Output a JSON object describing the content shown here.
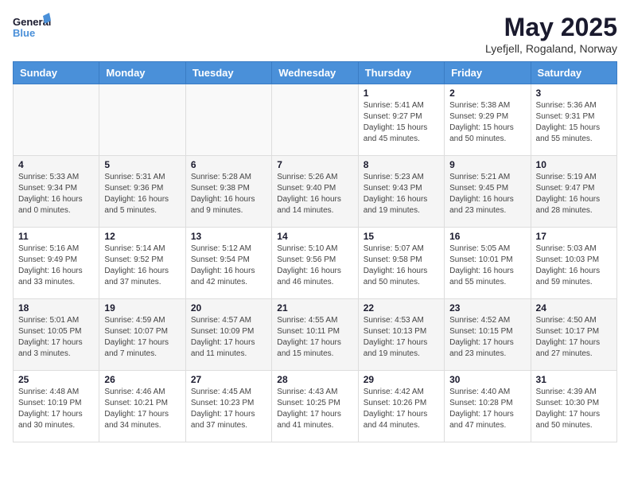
{
  "logo": {
    "line1": "General",
    "line2": "Blue"
  },
  "header": {
    "month": "May 2025",
    "location": "Lyefjell, Rogaland, Norway"
  },
  "weekdays": [
    "Sunday",
    "Monday",
    "Tuesday",
    "Wednesday",
    "Thursday",
    "Friday",
    "Saturday"
  ],
  "weeks": [
    [
      {
        "day": "",
        "info": ""
      },
      {
        "day": "",
        "info": ""
      },
      {
        "day": "",
        "info": ""
      },
      {
        "day": "",
        "info": ""
      },
      {
        "day": "1",
        "info": "Sunrise: 5:41 AM\nSunset: 9:27 PM\nDaylight: 15 hours\nand 45 minutes."
      },
      {
        "day": "2",
        "info": "Sunrise: 5:38 AM\nSunset: 9:29 PM\nDaylight: 15 hours\nand 50 minutes."
      },
      {
        "day": "3",
        "info": "Sunrise: 5:36 AM\nSunset: 9:31 PM\nDaylight: 15 hours\nand 55 minutes."
      }
    ],
    [
      {
        "day": "4",
        "info": "Sunrise: 5:33 AM\nSunset: 9:34 PM\nDaylight: 16 hours\nand 0 minutes."
      },
      {
        "day": "5",
        "info": "Sunrise: 5:31 AM\nSunset: 9:36 PM\nDaylight: 16 hours\nand 5 minutes."
      },
      {
        "day": "6",
        "info": "Sunrise: 5:28 AM\nSunset: 9:38 PM\nDaylight: 16 hours\nand 9 minutes."
      },
      {
        "day": "7",
        "info": "Sunrise: 5:26 AM\nSunset: 9:40 PM\nDaylight: 16 hours\nand 14 minutes."
      },
      {
        "day": "8",
        "info": "Sunrise: 5:23 AM\nSunset: 9:43 PM\nDaylight: 16 hours\nand 19 minutes."
      },
      {
        "day": "9",
        "info": "Sunrise: 5:21 AM\nSunset: 9:45 PM\nDaylight: 16 hours\nand 23 minutes."
      },
      {
        "day": "10",
        "info": "Sunrise: 5:19 AM\nSunset: 9:47 PM\nDaylight: 16 hours\nand 28 minutes."
      }
    ],
    [
      {
        "day": "11",
        "info": "Sunrise: 5:16 AM\nSunset: 9:49 PM\nDaylight: 16 hours\nand 33 minutes."
      },
      {
        "day": "12",
        "info": "Sunrise: 5:14 AM\nSunset: 9:52 PM\nDaylight: 16 hours\nand 37 minutes."
      },
      {
        "day": "13",
        "info": "Sunrise: 5:12 AM\nSunset: 9:54 PM\nDaylight: 16 hours\nand 42 minutes."
      },
      {
        "day": "14",
        "info": "Sunrise: 5:10 AM\nSunset: 9:56 PM\nDaylight: 16 hours\nand 46 minutes."
      },
      {
        "day": "15",
        "info": "Sunrise: 5:07 AM\nSunset: 9:58 PM\nDaylight: 16 hours\nand 50 minutes."
      },
      {
        "day": "16",
        "info": "Sunrise: 5:05 AM\nSunset: 10:01 PM\nDaylight: 16 hours\nand 55 minutes."
      },
      {
        "day": "17",
        "info": "Sunrise: 5:03 AM\nSunset: 10:03 PM\nDaylight: 16 hours\nand 59 minutes."
      }
    ],
    [
      {
        "day": "18",
        "info": "Sunrise: 5:01 AM\nSunset: 10:05 PM\nDaylight: 17 hours\nand 3 minutes."
      },
      {
        "day": "19",
        "info": "Sunrise: 4:59 AM\nSunset: 10:07 PM\nDaylight: 17 hours\nand 7 minutes."
      },
      {
        "day": "20",
        "info": "Sunrise: 4:57 AM\nSunset: 10:09 PM\nDaylight: 17 hours\nand 11 minutes."
      },
      {
        "day": "21",
        "info": "Sunrise: 4:55 AM\nSunset: 10:11 PM\nDaylight: 17 hours\nand 15 minutes."
      },
      {
        "day": "22",
        "info": "Sunrise: 4:53 AM\nSunset: 10:13 PM\nDaylight: 17 hours\nand 19 minutes."
      },
      {
        "day": "23",
        "info": "Sunrise: 4:52 AM\nSunset: 10:15 PM\nDaylight: 17 hours\nand 23 minutes."
      },
      {
        "day": "24",
        "info": "Sunrise: 4:50 AM\nSunset: 10:17 PM\nDaylight: 17 hours\nand 27 minutes."
      }
    ],
    [
      {
        "day": "25",
        "info": "Sunrise: 4:48 AM\nSunset: 10:19 PM\nDaylight: 17 hours\nand 30 minutes."
      },
      {
        "day": "26",
        "info": "Sunrise: 4:46 AM\nSunset: 10:21 PM\nDaylight: 17 hours\nand 34 minutes."
      },
      {
        "day": "27",
        "info": "Sunrise: 4:45 AM\nSunset: 10:23 PM\nDaylight: 17 hours\nand 37 minutes."
      },
      {
        "day": "28",
        "info": "Sunrise: 4:43 AM\nSunset: 10:25 PM\nDaylight: 17 hours\nand 41 minutes."
      },
      {
        "day": "29",
        "info": "Sunrise: 4:42 AM\nSunset: 10:26 PM\nDaylight: 17 hours\nand 44 minutes."
      },
      {
        "day": "30",
        "info": "Sunrise: 4:40 AM\nSunset: 10:28 PM\nDaylight: 17 hours\nand 47 minutes."
      },
      {
        "day": "31",
        "info": "Sunrise: 4:39 AM\nSunset: 10:30 PM\nDaylight: 17 hours\nand 50 minutes."
      }
    ]
  ]
}
